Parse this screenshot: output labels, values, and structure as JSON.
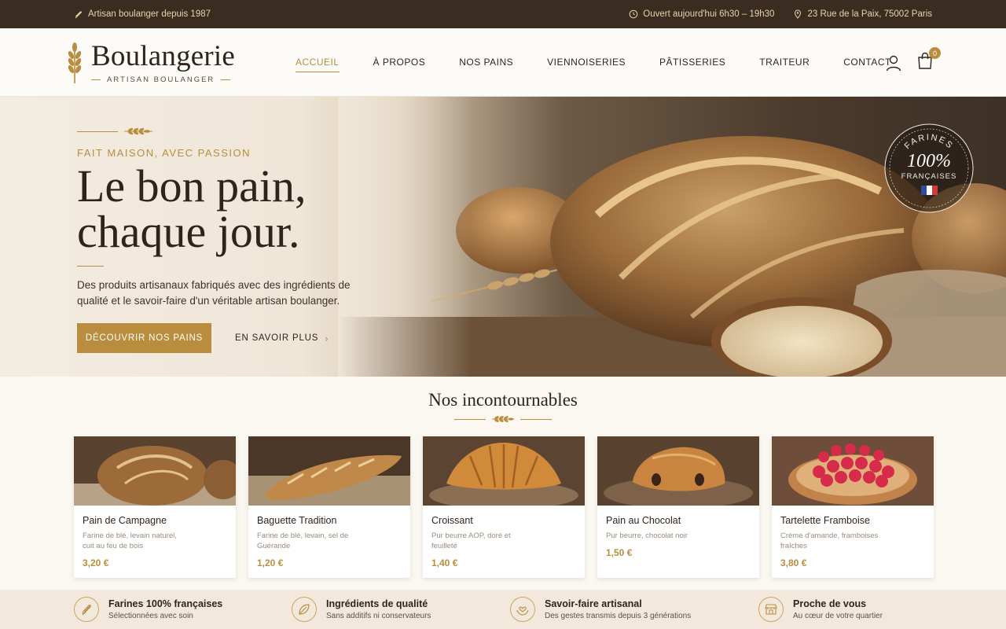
{
  "topbar": {
    "left_text": "Artisan boulanger depuis 1987",
    "hours": "Ouvert aujourd'hui 6h30 – 19h30",
    "address": "23 Rue de la Paix, 75002 Paris"
  },
  "header": {
    "brand": "Boulangerie",
    "tagline": "ARTISAN BOULANGER",
    "nav": [
      "ACCUEIL",
      "À PROPOS",
      "NOS PAINS",
      "VIENNOISERIES",
      "PÂTISSERIES",
      "TRAITEUR",
      "CONTACT"
    ],
    "active_nav": "ACCUEIL",
    "cart_count": "0"
  },
  "hero": {
    "kicker": "FAIT MAISON, AVEC PASSION",
    "headline_line1": "Le bon pain,",
    "headline_line2": "chaque jour.",
    "description": "Des produits artisanaux fabriqués avec des ingrédients de qualité et le savoir-faire d'un véritable artisan boulanger.",
    "primary_cta": "DÉCOUVRIR NOS PAINS",
    "secondary_cta": "EN SAVOIR PLUS",
    "seal": {
      "top": "FARINES",
      "middle": "100%",
      "bottom": "FRANÇAISES"
    }
  },
  "section": {
    "title": "Nos incontournables",
    "products": [
      {
        "name": "Pain de Campagne",
        "desc": "Farine de blé, levain naturel, cuit au feu de bois",
        "price": "3,20 €"
      },
      {
        "name": "Baguette Tradition",
        "desc": "Farine de blé, levain, sel de Guérande",
        "price": "1,20 €"
      },
      {
        "name": "Croissant",
        "desc": "Pur beurre AOP, doré et feuilleté",
        "price": "1,40 €"
      },
      {
        "name": "Pain au Chocolat",
        "desc": "Pur beurre, chocolat noir",
        "price": "1,50 €"
      },
      {
        "name": "Tartelette Framboise",
        "desc": "Crème d'amande, framboises fraîches",
        "price": "3,80 €"
      }
    ]
  },
  "features": [
    {
      "title": "Farines 100% françaises",
      "subtitle": "Sélectionnées avec soin",
      "icon": "wheat-icon"
    },
    {
      "title": "Ingrédients de qualité",
      "subtitle": "Sans additifs ni conservateurs",
      "icon": "leaf-icon"
    },
    {
      "title": "Savoir-faire artisanal",
      "subtitle": "Des gestes transmis depuis 3 générations",
      "icon": "hands-heart-icon"
    },
    {
      "title": "Proche de vous",
      "subtitle": "Au cœur de votre quartier",
      "icon": "storefront-icon"
    }
  ],
  "colors": {
    "accent": "#b98d3d",
    "dark": "#3a2c21",
    "text": "#2f241c",
    "background": "#fbf8f2"
  }
}
